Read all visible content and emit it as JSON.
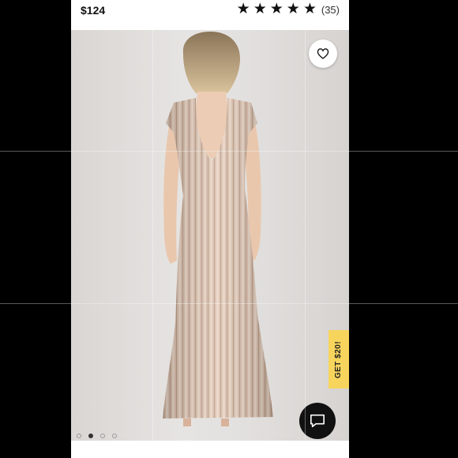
{
  "header": {
    "price": "$124",
    "stars": [
      "★",
      "★",
      "★",
      "★",
      "★"
    ],
    "review_count": "(35)"
  },
  "gallery": {
    "slide_count": 4,
    "active_index": 1,
    "image_subject": "product-photo-sequin-gown-back-view"
  },
  "promo": {
    "label": "GET $20!",
    "color": "#f7d45c"
  },
  "icons": {
    "favorite": "heart-icon",
    "chat": "chat-bubble-icon"
  },
  "colors": {
    "chat_button": "#111111",
    "favorite_button": "#ffffff"
  }
}
